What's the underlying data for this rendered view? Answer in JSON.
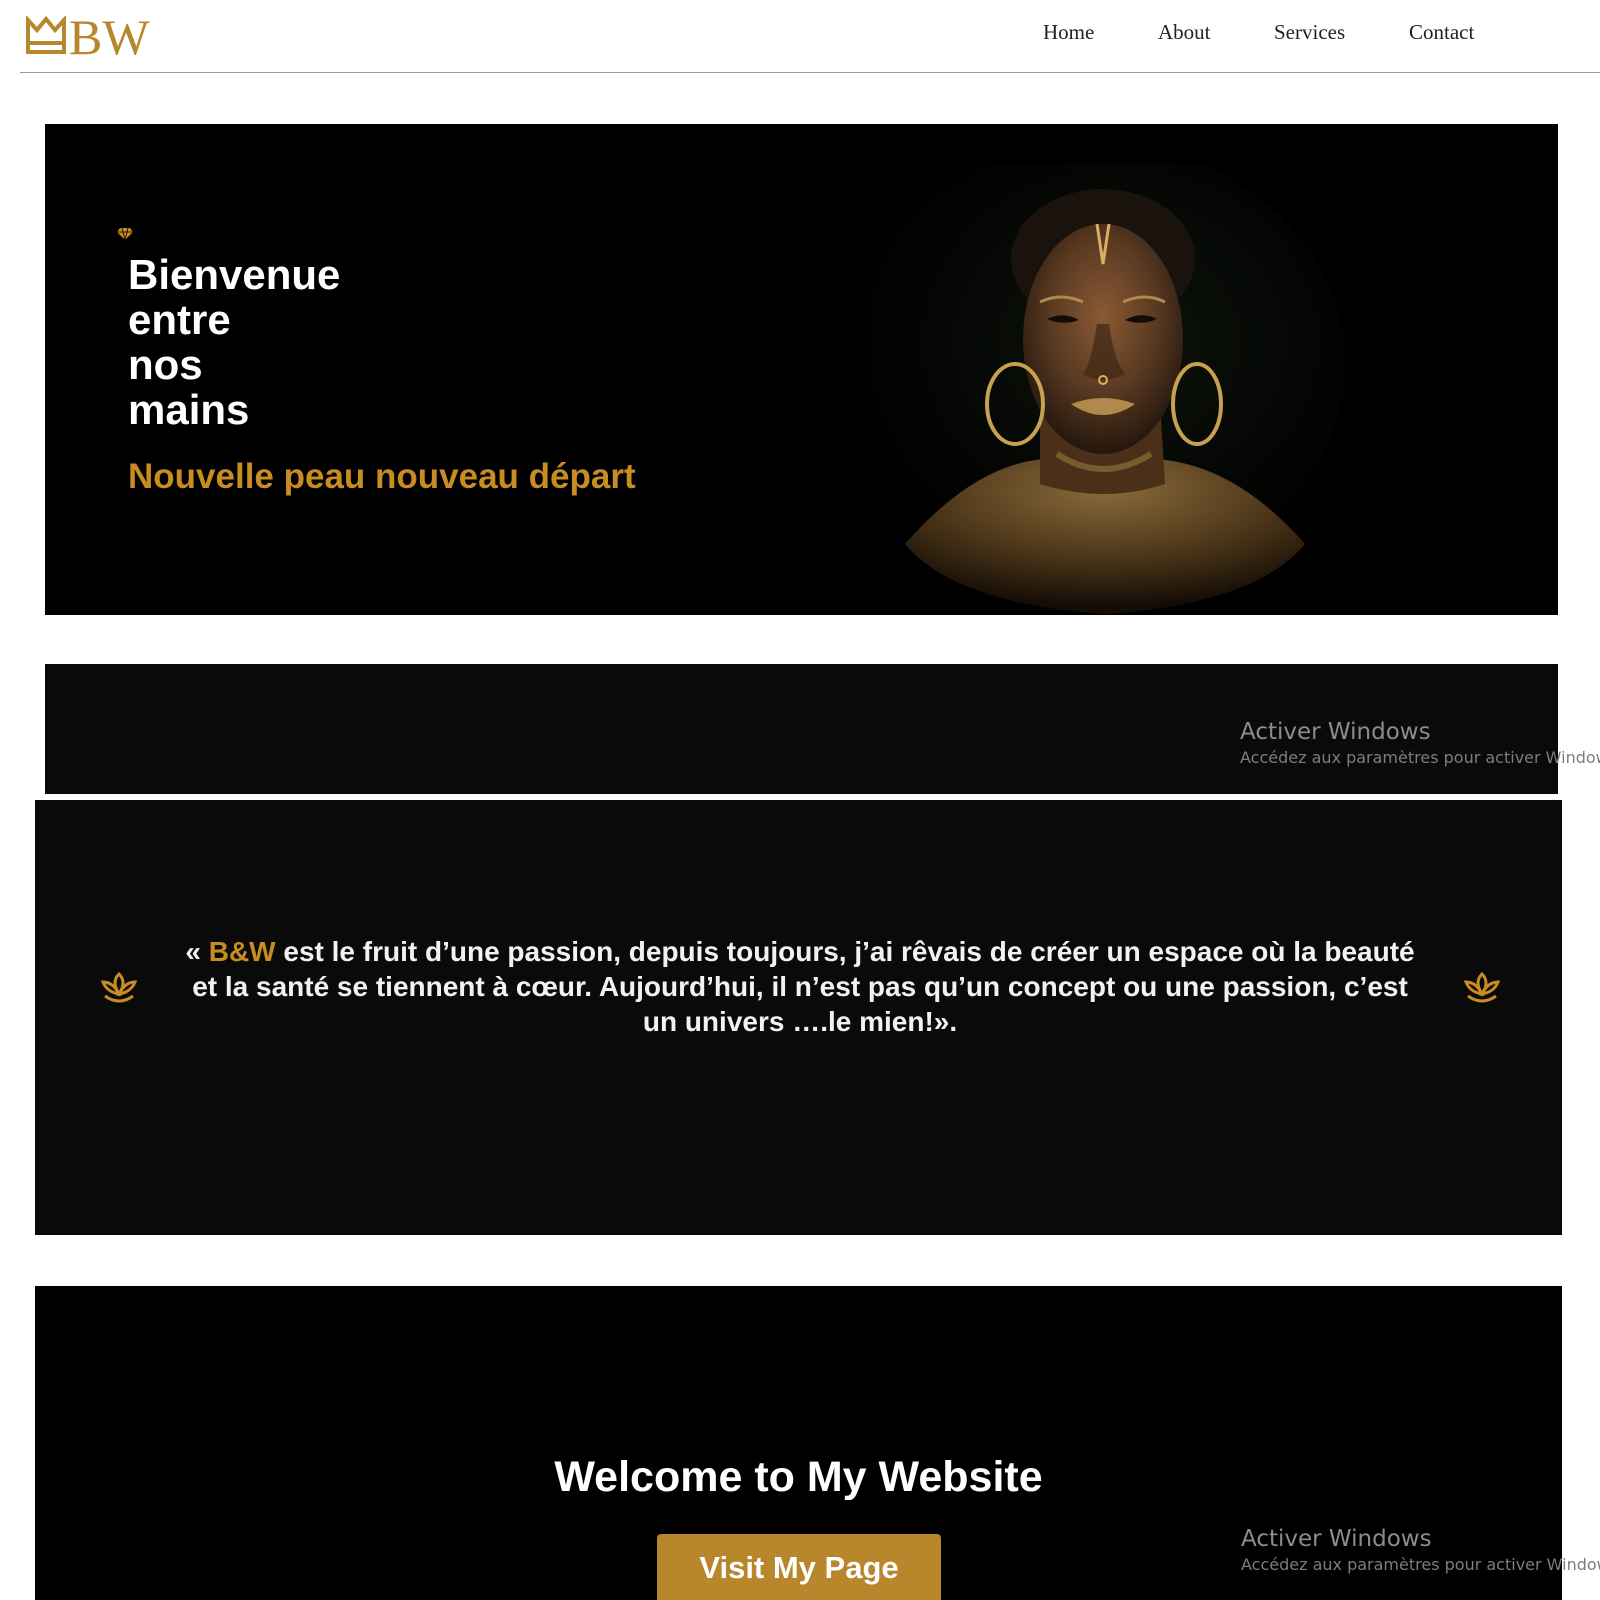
{
  "header": {
    "logo_text": "BW",
    "logo_icon": "crown-icon",
    "nav": [
      {
        "label": "Home"
      },
      {
        "label": "About"
      },
      {
        "label": "Services"
      },
      {
        "label": "Contact"
      }
    ]
  },
  "hero": {
    "icon": "diamond-icon",
    "title_lines": [
      "Bienvenue",
      "entre",
      "nos",
      "mains"
    ],
    "subtitle": "Nouvelle peau nouveau départ"
  },
  "quote": {
    "left_icon": "lotus-icon",
    "right_icon": "lotus-icon",
    "open": "« ",
    "brand": "B&W",
    "text": " est le fruit d’une passion, depuis toujours, j’ai rêvais de créer un espace où la beauté et la santé se tiennent à cœur. Aujourd’hui, il n’est pas qu’un concept ou une passion, c’est un univers ….le mien!»."
  },
  "welcome": {
    "title": "Welcome to My Website",
    "button_label": "Visit My Page"
  },
  "watermark": {
    "title": "Activer Windows",
    "subtitle": "Accédez aux paramètres pour activer Windows."
  },
  "colors": {
    "accent": "#c78d22",
    "logo": "#b8862b",
    "button": "#b8862b",
    "panel": "#000000"
  }
}
